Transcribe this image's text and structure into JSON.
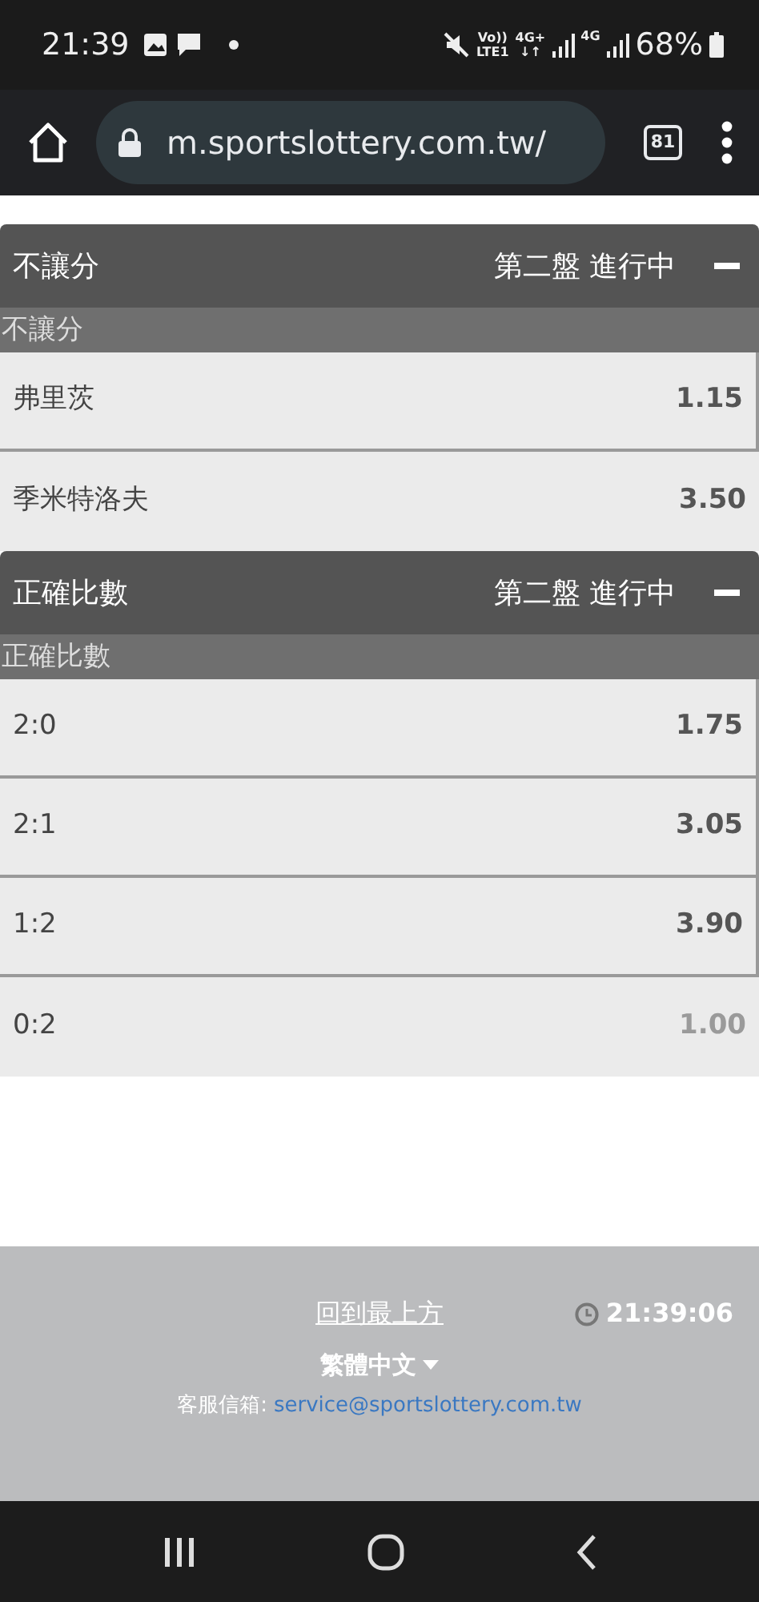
{
  "status_bar": {
    "time": "21:39",
    "network_top": "Vo))",
    "network_bottom": "LTE1",
    "net2_top": "4G+",
    "net2_bottom": "↓↑",
    "net3": "4G",
    "battery": "68%"
  },
  "browser": {
    "url": "m.sportslottery.com.tw/",
    "tab_count": "81"
  },
  "markets": [
    {
      "title": "不讓分",
      "status": "第二盤 進行中",
      "expanded": true,
      "subtitle": "不讓分",
      "outcomes": [
        {
          "name": "弗里茨",
          "odds": "1.15",
          "disabled": false
        },
        {
          "name": "季米特洛夫",
          "odds": "3.50",
          "disabled": false
        }
      ]
    },
    {
      "title": "正確比數",
      "status": "第二盤 進行中",
      "expanded": true,
      "subtitle": "正確比數",
      "outcomes": [
        {
          "name": "2:0",
          "odds": "1.75",
          "disabled": false
        },
        {
          "name": "2:1",
          "odds": "3.05",
          "disabled": false
        },
        {
          "name": "1:2",
          "odds": "3.90",
          "disabled": false
        },
        {
          "name": "0:2",
          "odds": "1.00",
          "disabled": true
        }
      ]
    }
  ],
  "footer": {
    "back_to_top": "回到最上方",
    "clock": "21:39:06",
    "language": "繁體中文",
    "email_label": "客服信箱:",
    "email": "service@sportslottery.com.tw"
  }
}
